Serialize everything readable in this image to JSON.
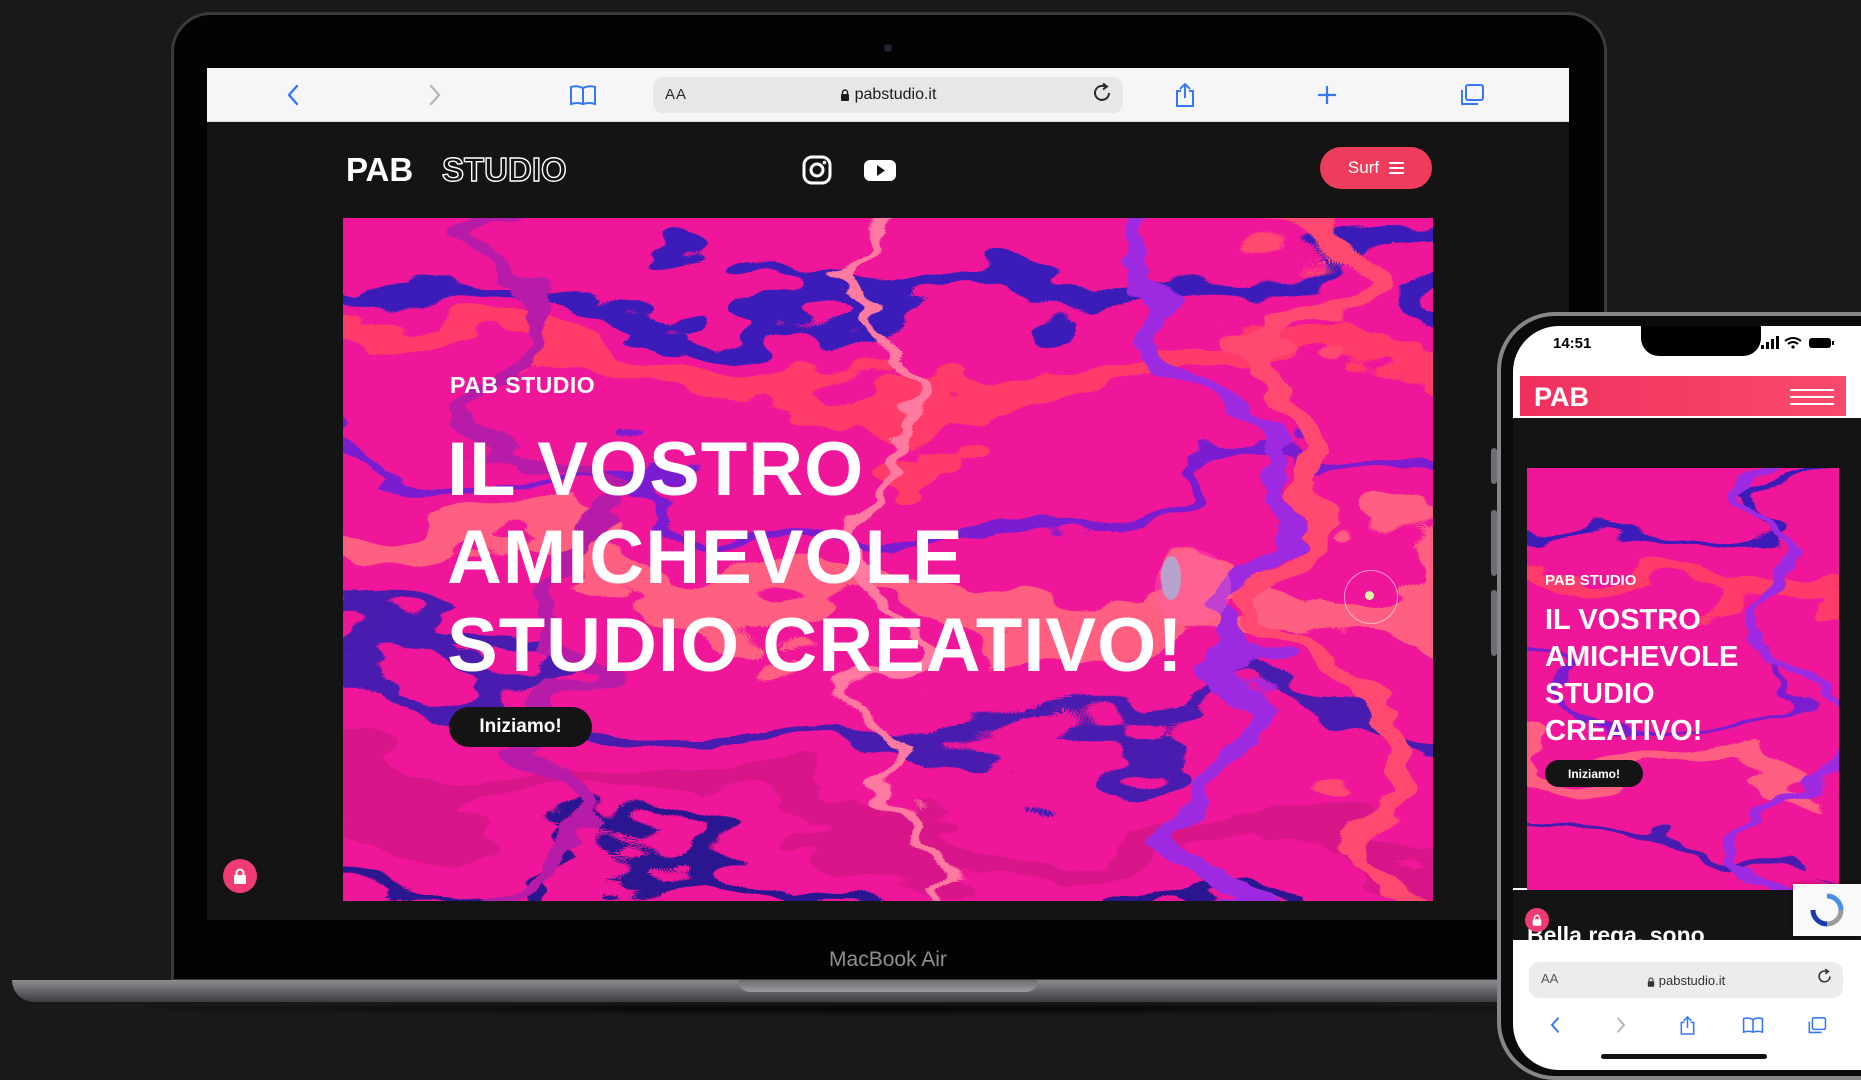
{
  "laptop": {
    "device_label": "MacBook Air",
    "browser": {
      "text_size_label": "AA",
      "url": "pabstudio.it",
      "back_icon": "chevron-left-icon",
      "forward_icon": "chevron-right-icon",
      "bookmarks_icon": "book-icon",
      "reload_icon": "reload-icon",
      "share_icon": "share-icon",
      "new_tab_icon": "plus-icon",
      "tabs_icon": "tabs-icon"
    },
    "site": {
      "logo": {
        "bold": "PAB",
        "outline": "STUDIO"
      },
      "social": [
        "instagram-icon",
        "youtube-icon"
      ],
      "menu_button": "Surf",
      "hero": {
        "kicker": "PAB STUDIO",
        "title": "IL VOSTRO AMICHEVOLE STUDIO CREATIVO!",
        "cta": "Iniziamo!"
      },
      "fab_icon": "lock-icon"
    }
  },
  "phone": {
    "time": "14:51",
    "site": {
      "logo": "PAB",
      "hero": {
        "kicker": "PAB STUDIO",
        "title": "IL VOSTRO AMICHEVOLE STUDIO CREATIVO!",
        "cta": "Iniziamo!"
      },
      "next_section_text": "Bella rega, sono"
    },
    "browser": {
      "text_size_label": "AA",
      "url": "pabstudio.it"
    }
  },
  "colors": {
    "accent": "#ee3c5c",
    "hero_magenta": "#f0199a",
    "page_bg": "#141414",
    "backdrop": "#191919"
  }
}
